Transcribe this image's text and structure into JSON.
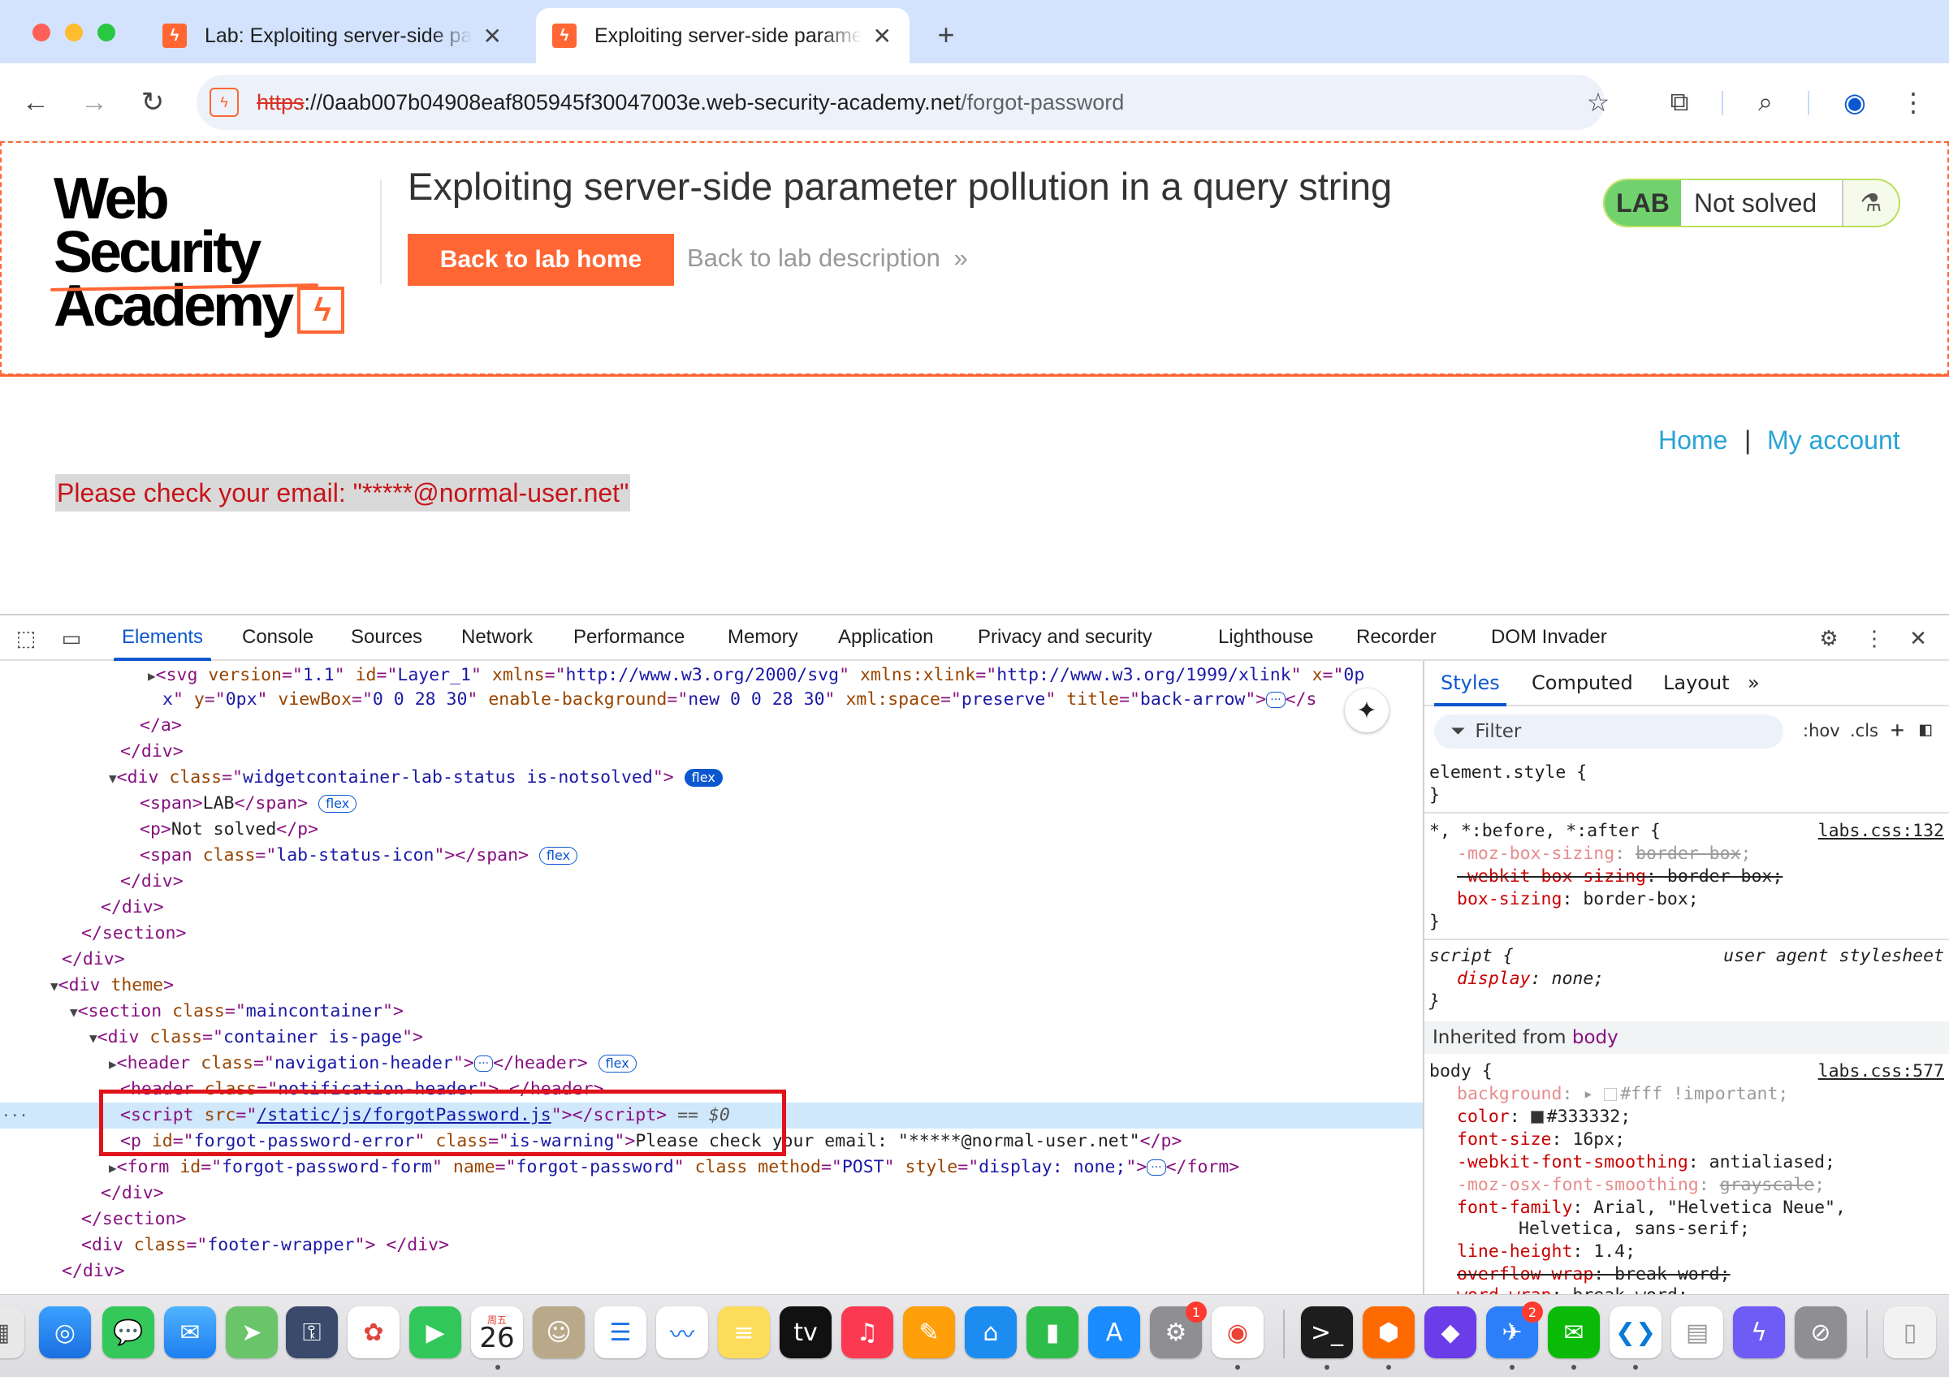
{
  "browser": {
    "tabs": [
      {
        "title": "Lab: Exploiting server-side pa",
        "active": false
      },
      {
        "title": "Exploiting server-side parame",
        "active": true
      }
    ],
    "new_tab_symbol": "+",
    "url": {
      "scheme": "https",
      "host": "://0aab007b04908eaf805945f30047003e.web-security-academy.net",
      "path": "/forgot-password"
    }
  },
  "lab_header": {
    "logo_line1": "Web Security",
    "logo_line2": "Academy",
    "title": "Exploiting server-side parameter pollution in a query string",
    "back_home_label": "Back to lab home",
    "back_description_label": "Back to lab description",
    "status_tag": "LAB",
    "status_text": "Not solved"
  },
  "page": {
    "nav_home": "Home",
    "nav_separator": "|",
    "nav_account": "My account",
    "email_message": "Please check your email: \"*****@normal-user.net\""
  },
  "devtools": {
    "tabs": [
      "Elements",
      "Console",
      "Sources",
      "Network",
      "Performance",
      "Memory",
      "Application",
      "Privacy and security",
      "Lighthouse",
      "Recorder",
      "DOM Invader"
    ],
    "active_tab": "Elements",
    "styles_tabs": [
      "Styles",
      "Computed",
      "Layout"
    ],
    "filter_placeholder": "Filter",
    "hov_label": ":hov",
    "cls_label": ".cls",
    "selected_marker": "== $0",
    "inherited_label": "Inherited from",
    "inherited_from": "body"
  },
  "colors": {
    "accent": "#ff6633",
    "devtools_blue": "#0b57d0",
    "highlight_red": "#e0131b",
    "link_blue": "#29a3d5",
    "error_red": "#c7141a",
    "lab_green": "#70d16d"
  },
  "dock": {
    "calendar_day": "26",
    "calendar_weekday": "周五",
    "badges": {
      "settings": "1",
      "feishu": "2"
    }
  }
}
